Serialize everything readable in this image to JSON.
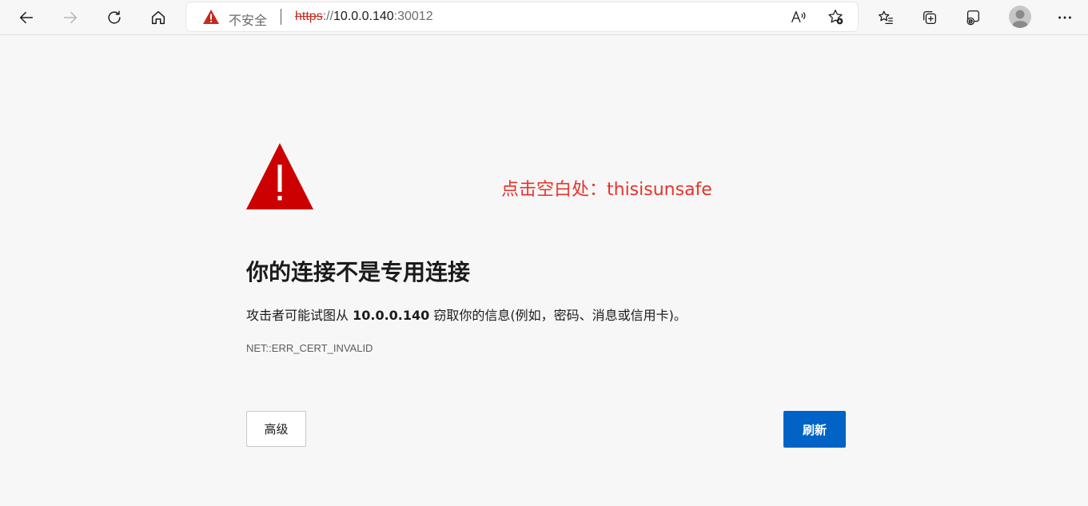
{
  "toolbar": {
    "back_icon": "arrow-left-icon",
    "forward_icon": "arrow-right-icon",
    "refresh_icon": "refresh-icon",
    "home_icon": "home-icon"
  },
  "address_bar": {
    "security_label": "不安全",
    "url_scheme": "https",
    "url_separator": "://",
    "url_host": "10.0.0.140",
    "url_port": ":30012",
    "warning_color": "#c42b1c"
  },
  "error_page": {
    "annotation": "点击空白处：thisisunsafe",
    "title": "你的连接不是专用连接",
    "description_before": "攻击者可能试图从 ",
    "description_host": "10.0.0.140",
    "description_after": " 窃取你的信息(例如，密码、消息或信用卡)。",
    "error_code": "NET::ERR_CERT_INVALID",
    "advanced_button": "高级",
    "refresh_button": "刷新",
    "accent_color": "#0063c5",
    "warning_color": "#cc0000"
  }
}
